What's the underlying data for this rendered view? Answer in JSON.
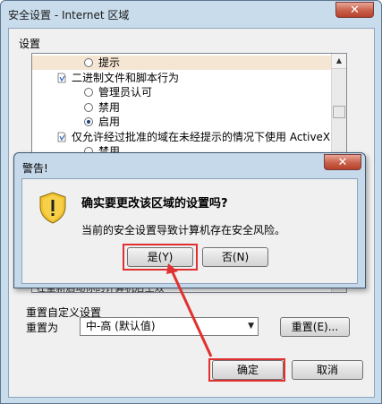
{
  "main_window": {
    "title": "安全设置 - Internet 区域",
    "close_glyph": "✕",
    "settings_label": "设置",
    "settings_items": [
      {
        "kind": "radio",
        "checked": false,
        "label": "提示",
        "highlight": true
      },
      {
        "kind": "category",
        "label": "二进制文件和脚本行为"
      },
      {
        "kind": "radio",
        "checked": false,
        "label": "管理员认可"
      },
      {
        "kind": "radio",
        "checked": false,
        "label": "禁用"
      },
      {
        "kind": "radio",
        "checked": true,
        "label": "启用"
      },
      {
        "kind": "category",
        "label": "仅允许经过批准的域在未经提示的情况下使用 ActiveX"
      },
      {
        "kind": "radio",
        "checked": false,
        "label": "禁用"
      }
    ],
    "note": "*在重新启动你的计算机后生效",
    "reset_group_title": "重置自定义设置",
    "reset_to_label": "重置为",
    "reset_select_value": "中-高 (默认值)",
    "reset_button": "重置(E)...",
    "ok_button": "确定",
    "cancel_button": "取消"
  },
  "warning_dialog": {
    "title": "警告!",
    "close_glyph": "✕",
    "question": "确实要更改该区域的设置吗?",
    "detail": "当前的安全设置导致计算机存在安全风险。",
    "yes_button": "是(Y)",
    "no_button": "否(N)",
    "icon": "shield-warning-icon"
  },
  "annotation": {
    "highlight_color": "#e13030"
  }
}
